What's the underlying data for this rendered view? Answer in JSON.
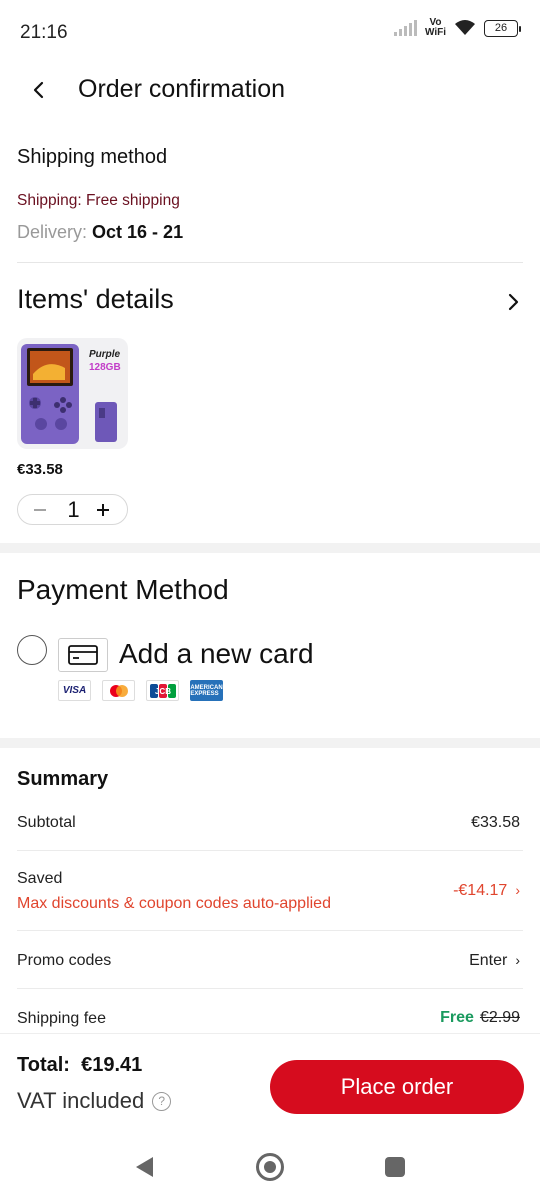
{
  "status_bar": {
    "time": "21:16",
    "vowifi_top": "Vo",
    "vowifi_bottom": "WiFi",
    "battery": "26"
  },
  "header": {
    "title": "Order confirmation"
  },
  "shipping": {
    "title": "Shipping method",
    "shipping_line": "Shipping: Free shipping",
    "delivery_label": "Delivery:",
    "delivery_dates": "Oct 16 - 21"
  },
  "items": {
    "title": "Items' details",
    "product": {
      "badge_color": "Purple",
      "badge_storage": "128GB",
      "price": "€33.58",
      "quantity": "1"
    }
  },
  "payment": {
    "title": "Payment Method",
    "add_card_label": "Add a new card",
    "brands": {
      "visa": "VISA",
      "jcb": "JCB",
      "amex": "AMERICAN EXPRESS"
    }
  },
  "summary": {
    "title": "Summary",
    "subtotal_label": "Subtotal",
    "subtotal_value": "€33.58",
    "saved_label": "Saved",
    "saved_note": "Max discounts & coupon codes auto-applied",
    "saved_value": "-€14.17",
    "promo_label": "Promo codes",
    "promo_value": "Enter",
    "shipping_fee_label": "Shipping fee",
    "shipping_fee_free": "Free",
    "shipping_fee_original": "€2.99"
  },
  "footer": {
    "total_label": "Total:",
    "total_value": "€19.41",
    "vat_label": "VAT included",
    "place_order_label": "Place order"
  },
  "colors": {
    "accent": "#d60c1e",
    "discount": "#e0452e",
    "free": "#1a9a5e"
  }
}
